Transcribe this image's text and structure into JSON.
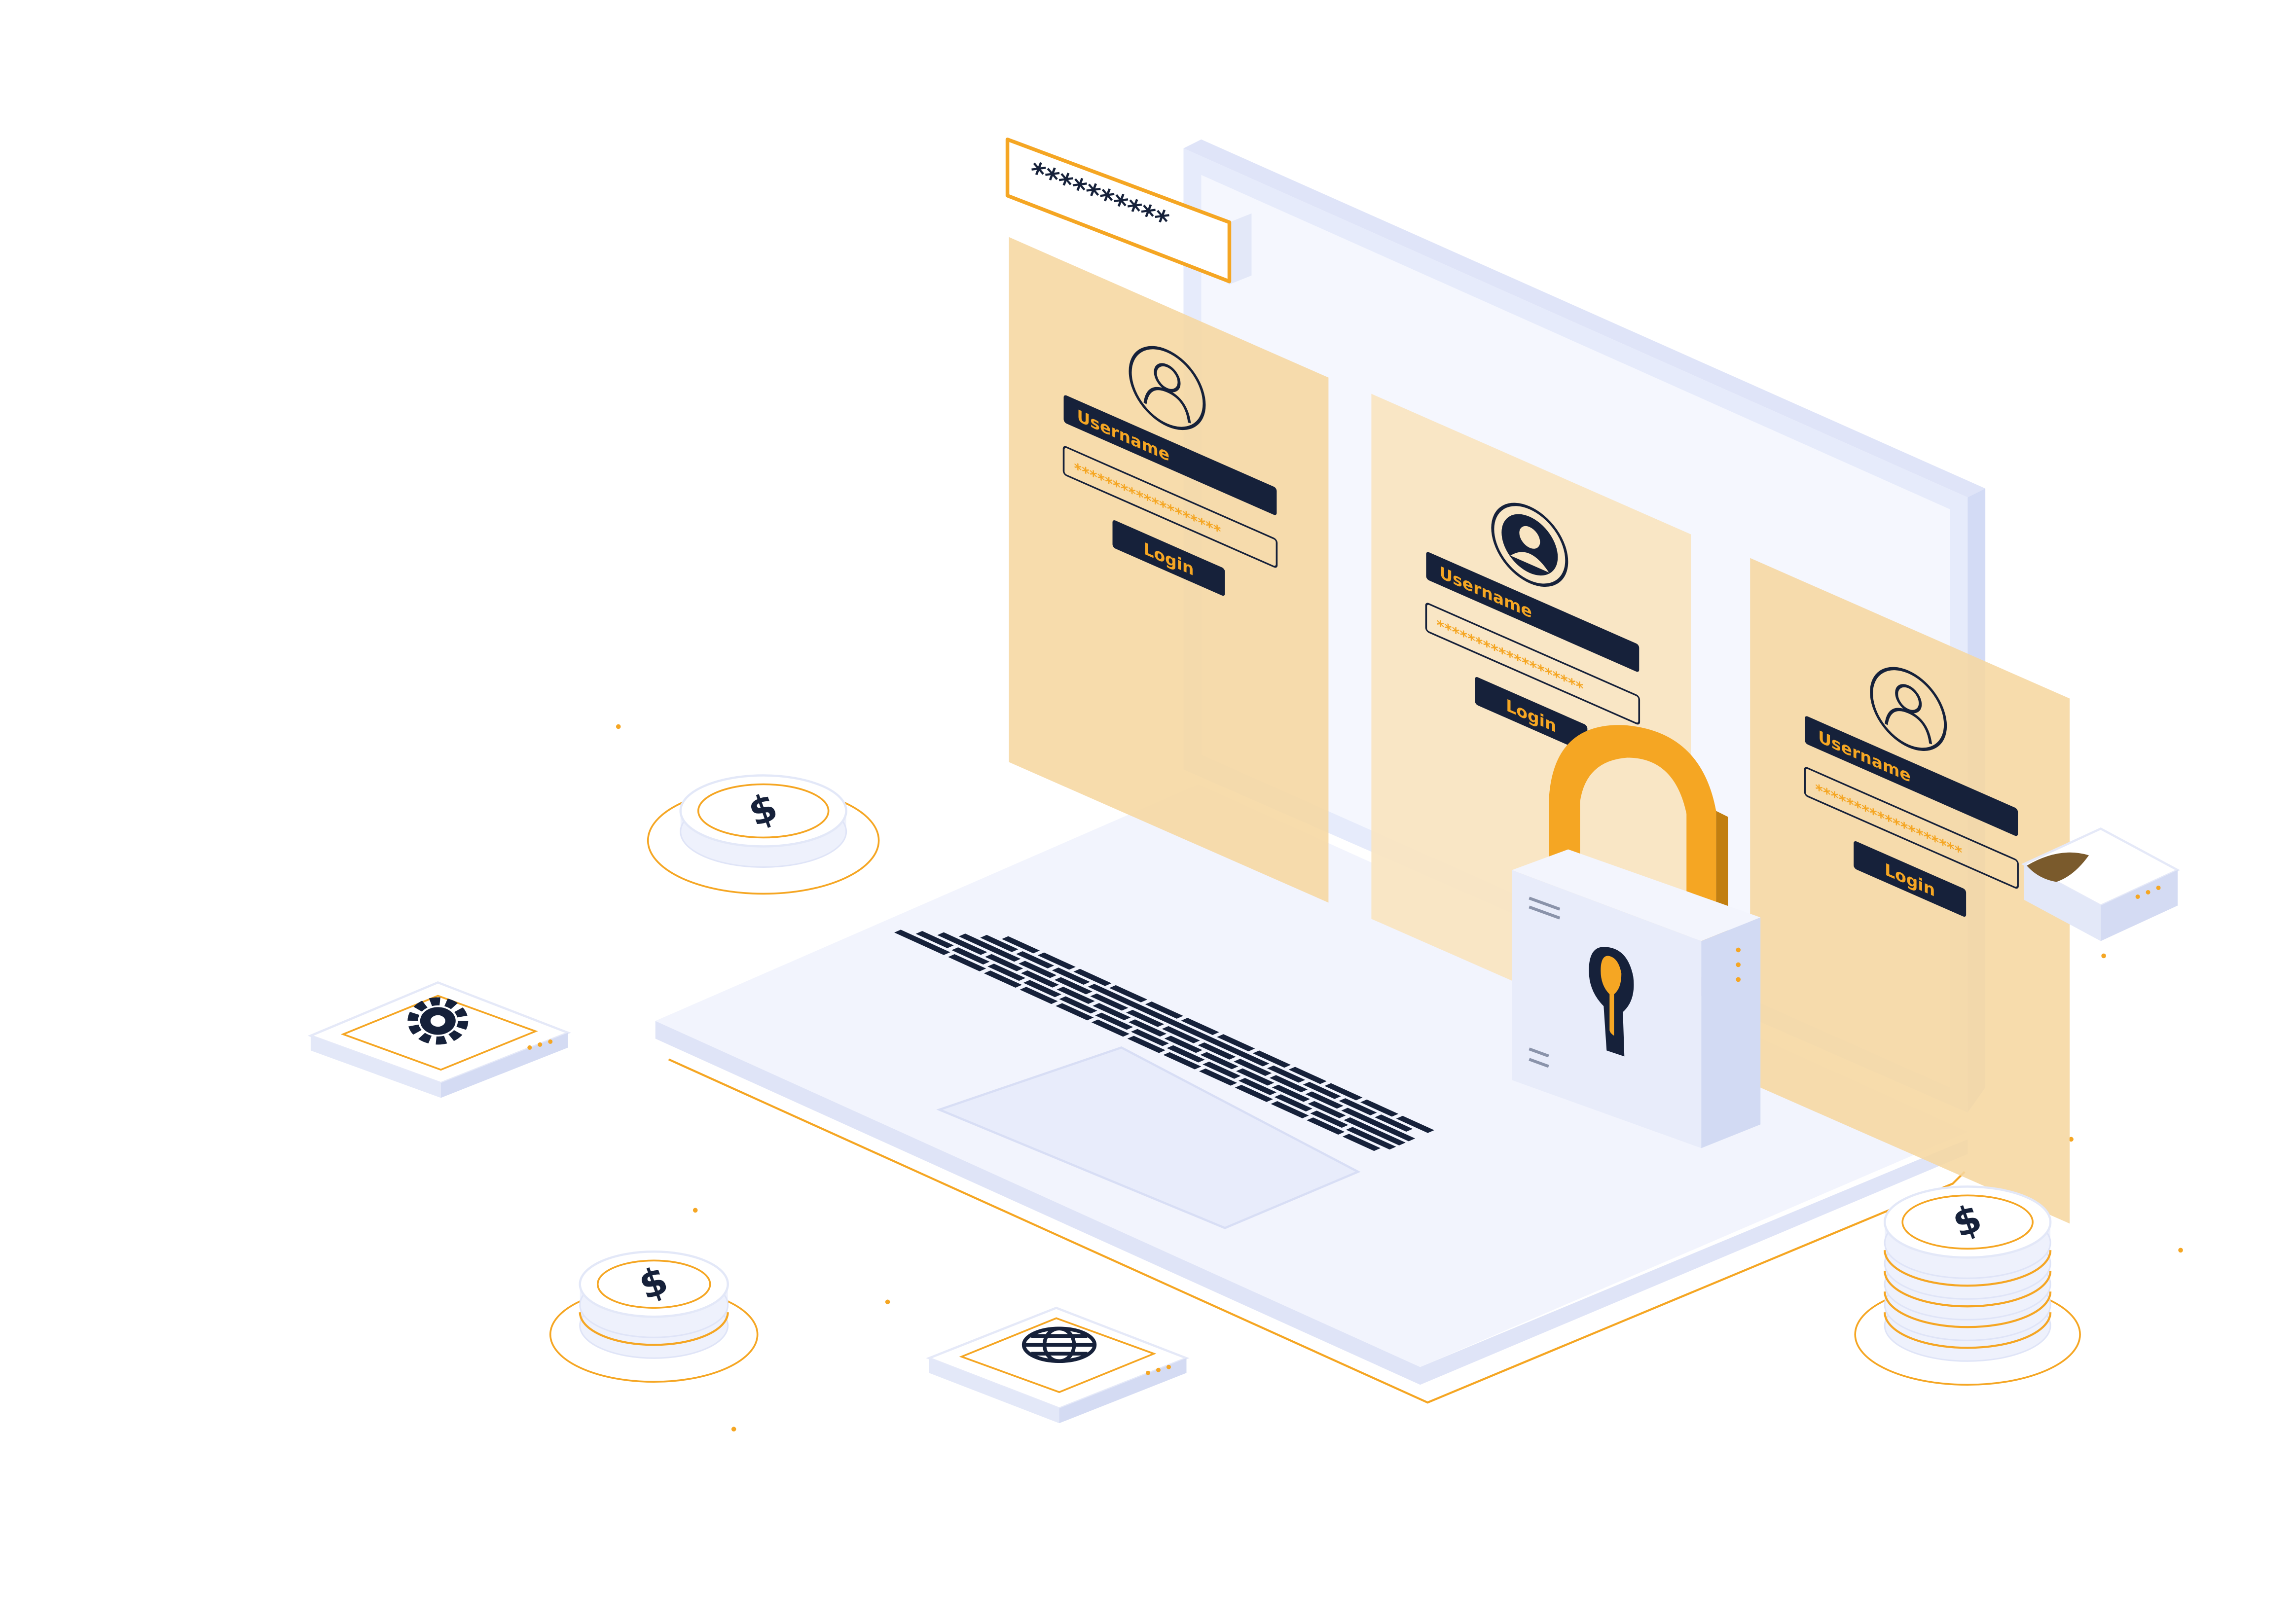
{
  "palette": {
    "navy": "#16213a",
    "orange": "#f5a623",
    "peach": "#f8d9a6",
    "lavender": "#e6ebfb",
    "white": "#ffffff"
  },
  "password_popup": {
    "text": "**********"
  },
  "login_cards": [
    {
      "username_label": "Username",
      "password_mask": "*******************",
      "login_label": "Login"
    },
    {
      "username_label": "Username",
      "password_mask": "*******************",
      "login_label": "Login"
    },
    {
      "username_label": "Username",
      "password_mask": "*******************",
      "login_label": "Login"
    }
  ],
  "icons": {
    "user": "user-icon",
    "padlock": "padlock-icon",
    "gear": "gear-icon",
    "globe": "globe-icon",
    "dollar": "dollar-icon",
    "shield": "shield-icon"
  },
  "coins": [
    {
      "symbol": "$"
    },
    {
      "symbol": "$"
    },
    {
      "symbol": "$"
    }
  ]
}
